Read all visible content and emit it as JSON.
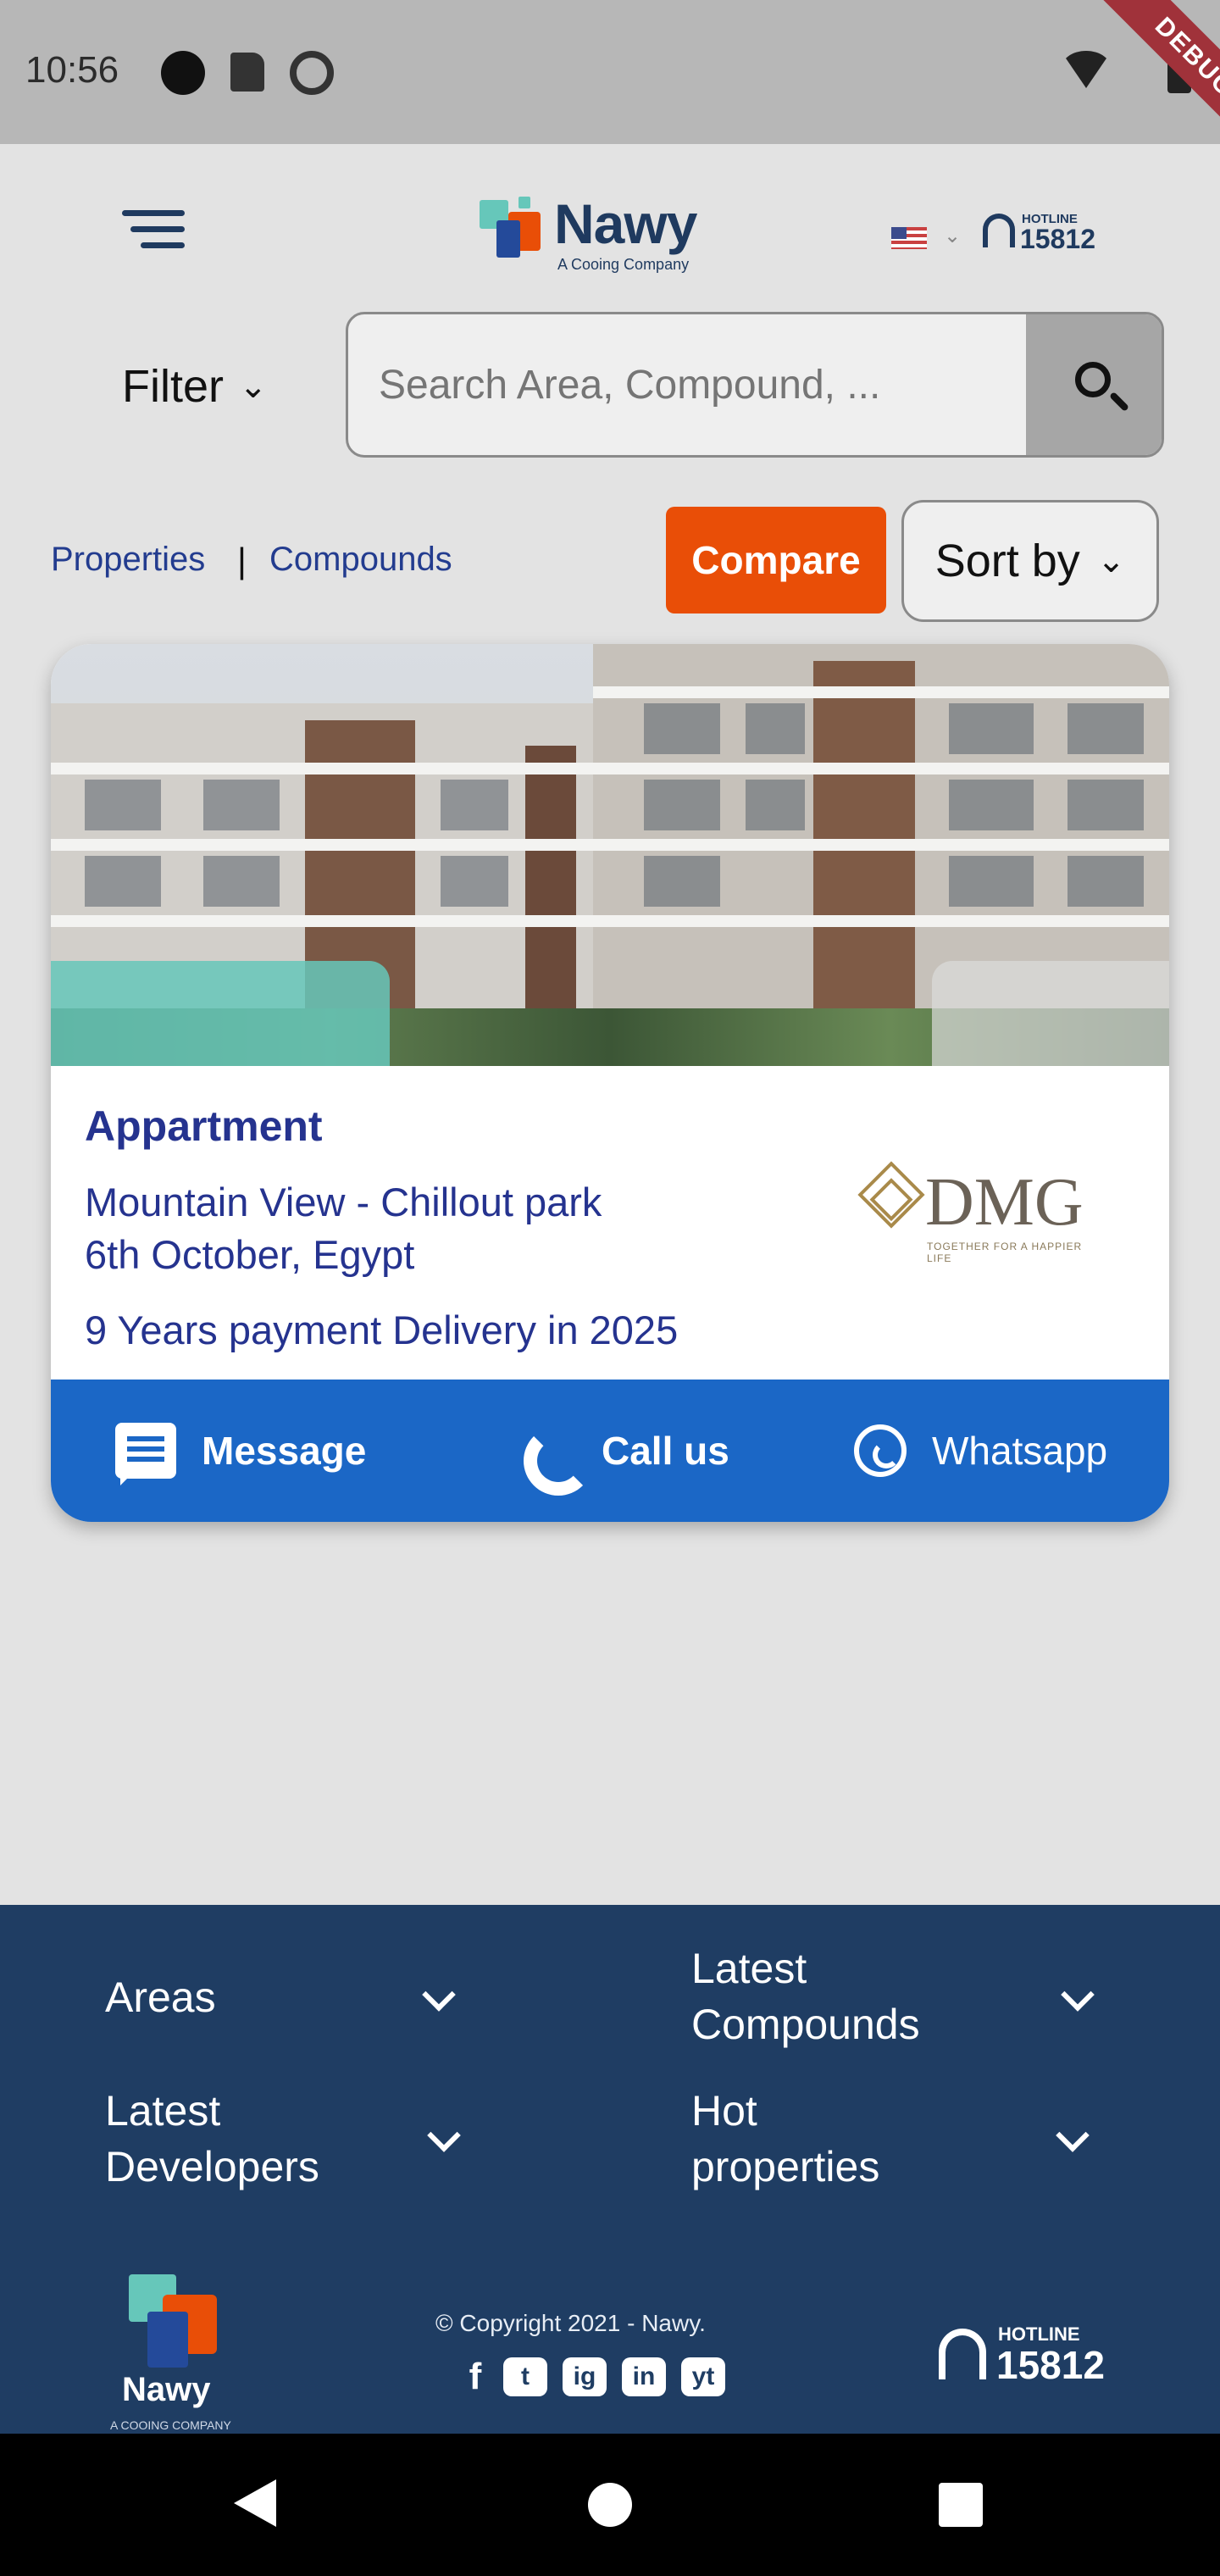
{
  "status_bar": {
    "time": "10:56",
    "debug_label": "DEBUG"
  },
  "header": {
    "brand": "Nawy",
    "brand_tag": "A Cooing Company",
    "hotline_label": "HOTLINE",
    "hotline_number": "15812"
  },
  "search": {
    "filter_label": "Filter",
    "placeholder": "Search Area, Compound, ..."
  },
  "tabs": {
    "properties": "Properties",
    "separator": "|",
    "compounds": "Compounds",
    "compare": "Compare",
    "sort": "Sort by"
  },
  "listing": {
    "type": "Appartment",
    "location_line1": "Mountain View - Chillout park",
    "location_line2": "6th October, Egypt",
    "payment": "9 Years payment Delivery in 2025",
    "developer": "DMG",
    "developer_tag": "TOGETHER FOR A HAPPIER LIFE",
    "actions": {
      "message": "Message",
      "call": "Call us",
      "whatsapp": "Whatsapp"
    }
  },
  "footer": {
    "areas": "Areas",
    "latest_compounds_1": "Latest",
    "latest_compounds_2": "Compounds",
    "latest_developers_1": "Latest",
    "latest_developers_2": "Developers",
    "hot_properties_1": "Hot",
    "hot_properties_2": "properties",
    "brand": "Nawy",
    "brand_tag": "A COOING COMPANY",
    "copyright": "© Copyright 2021 - Nawy.",
    "hotline_label": "HOTLINE",
    "hotline_number": "15812",
    "socials": [
      "f",
      "t",
      "ig",
      "in",
      "yt"
    ]
  },
  "colors": {
    "brand_navy": "#1f3d63",
    "accent_orange": "#e94e07",
    "action_blue": "#1b67c6",
    "text_blue": "#25338f",
    "teal": "#66c7ba"
  }
}
